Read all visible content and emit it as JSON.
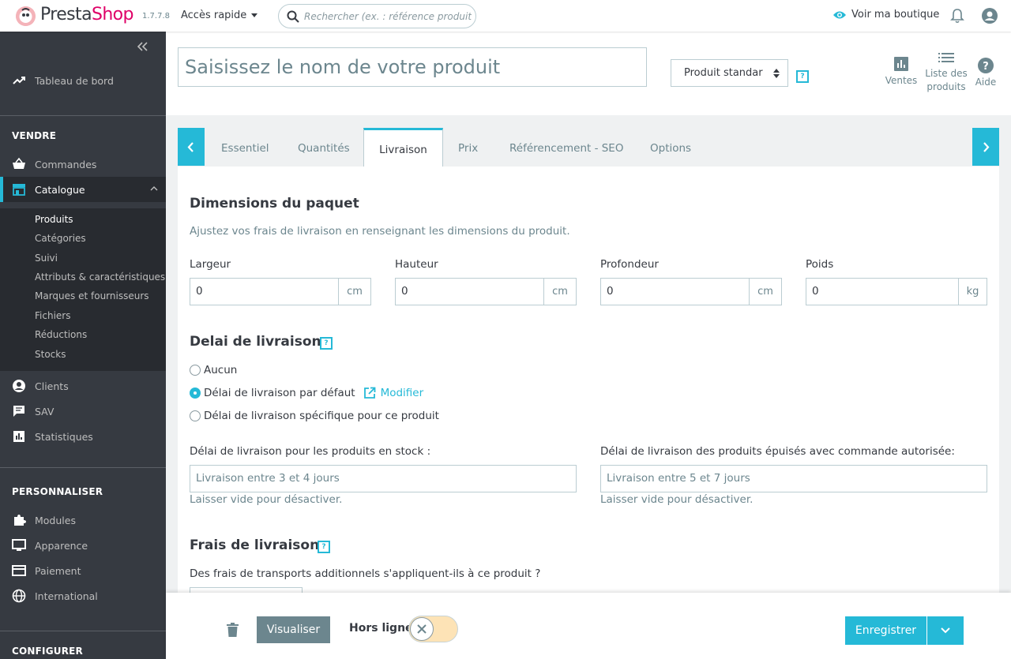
{
  "header": {
    "brand_presta": "Presta",
    "brand_shop": "Shop",
    "version": "1.7.7.8",
    "quick_access": "Accès rapide",
    "search_placeholder": "Rechercher (ex. : référence produit, nom",
    "view_shop": "Voir ma boutique"
  },
  "sidebar": {
    "dashboard": "Tableau de bord",
    "sections": {
      "sell": "VENDRE",
      "customize": "PERSONNALISER",
      "configure": "CONFIGURER"
    },
    "sell_items": [
      "Commandes",
      "Catalogue"
    ],
    "catalog_sub": [
      "Produits",
      "Catégories",
      "Suivi",
      "Attributs & caractéristiques",
      "Marques et fournisseurs",
      "Fichiers",
      "Réductions",
      "Stocks"
    ],
    "more_items": [
      "Clients",
      "SAV",
      "Statistiques"
    ],
    "customize_items": [
      "Modules",
      "Apparence",
      "Paiement",
      "International"
    ]
  },
  "page_header": {
    "product_name_placeholder": "Saisissez le nom de votre produit",
    "product_type": "Produit standar",
    "help_mark": "?",
    "toolbar": {
      "sales": "Ventes",
      "product_list_l1": "Liste des",
      "product_list_l2": "produits",
      "help": "Aide"
    }
  },
  "tabs": [
    "Essentiel",
    "Quantités",
    "Livraison",
    "Prix",
    "Référencement - SEO",
    "Options"
  ],
  "shipping": {
    "dimensions_title": "Dimensions du paquet",
    "dimensions_hint": "Ajustez vos frais de livraison en renseignant les dimensions du produit.",
    "width": {
      "label": "Largeur",
      "value": "0",
      "unit": "cm"
    },
    "height": {
      "label": "Hauteur",
      "value": "0",
      "unit": "cm"
    },
    "depth": {
      "label": "Profondeur",
      "value": "0",
      "unit": "cm"
    },
    "weight": {
      "label": "Poids",
      "value": "0",
      "unit": "kg"
    },
    "delay_title": "Delai de livraison",
    "delay_options": [
      "Aucun",
      "Délai de livraison par défaut",
      "Délai de livraison spécifique pour ce produit"
    ],
    "modify_link": "Modifier",
    "in_stock_label": "Délai de livraison pour les produits en stock :",
    "in_stock_placeholder": "Livraison entre 3 et 4 jours",
    "out_stock_label": "Délai de livraison des produits épuisés avec commande autorisée:",
    "out_stock_placeholder": "Livraison entre 5 et 7 jours",
    "leave_empty": "Laisser vide pour désactiver.",
    "fees_title": "Frais de livraison",
    "fees_question": "Des frais de transports additionnels s'appliquent-ils à ce produit ?"
  },
  "footer": {
    "preview": "Visualiser",
    "offline": "Hors ligne",
    "save": "Enregistrer"
  },
  "colors": {
    "accent": "#25b9d7",
    "sidebar": "#363a41",
    "brand_pink": "#df0067"
  }
}
